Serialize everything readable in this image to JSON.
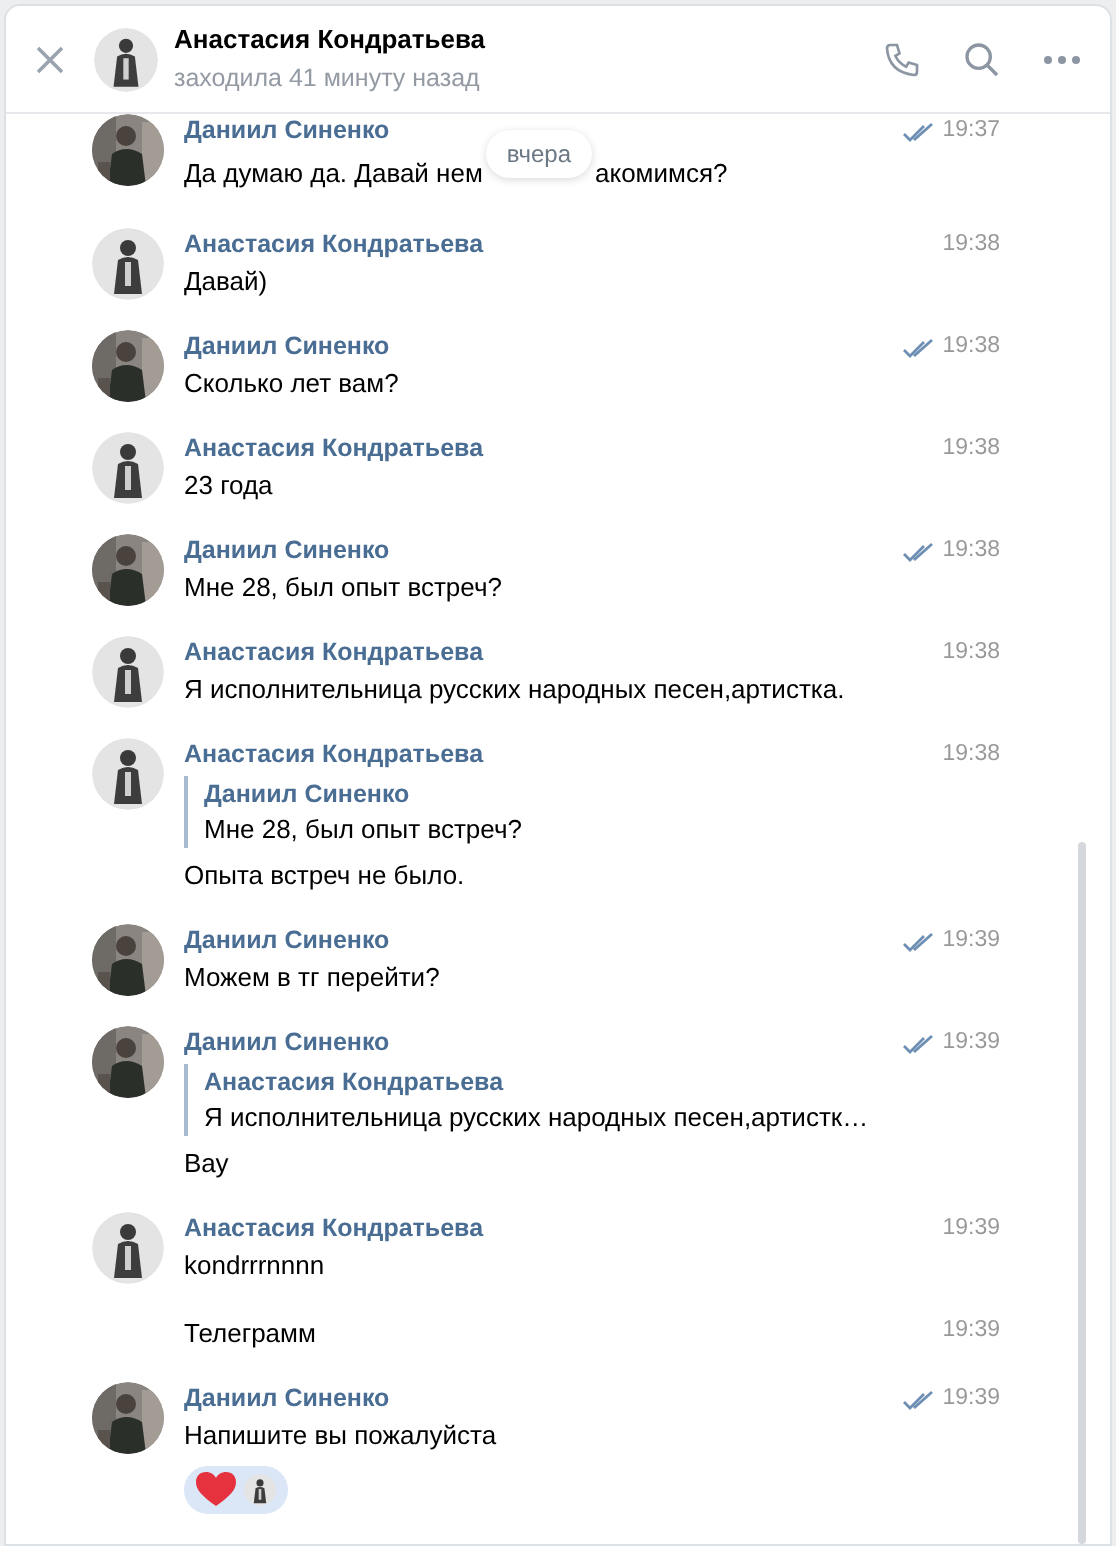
{
  "header": {
    "name": "Анастасия Кондратьева",
    "status": "заходила 41 минуту назад"
  },
  "date_badge": "вчера",
  "messages": [
    {
      "author": "Даниил Синенко",
      "avatar": {
        "kind": "dark"
      },
      "time": "19:37",
      "read": true,
      "text_parts": [
        "Да думаю да. Давай нем",
        "акомимся?"
      ]
    },
    {
      "author": "Анастасия Кондратьева",
      "avatar": {
        "kind": "light"
      },
      "time": "19:38",
      "read": false,
      "text_parts": [
        "Давай)"
      ]
    },
    {
      "author": "Даниил Синенко",
      "avatar": {
        "kind": "dark"
      },
      "time": "19:38",
      "read": true,
      "text_parts": [
        "Сколько лет вам?"
      ]
    },
    {
      "author": "Анастасия Кондратьева",
      "avatar": {
        "kind": "light"
      },
      "time": "19:38",
      "read": false,
      "text_parts": [
        "23 года"
      ]
    },
    {
      "author": "Даниил Синенко",
      "avatar": {
        "kind": "dark"
      },
      "time": "19:38",
      "read": true,
      "text_parts": [
        "Мне 28, был опыт встреч?"
      ]
    },
    {
      "author": "Анастасия Кондратьева",
      "avatar": {
        "kind": "light"
      },
      "time": "19:38",
      "read": false,
      "text_parts": [
        "Я исполнительница русских народных песен,артистка."
      ]
    },
    {
      "author": "Анастасия Кондратьева",
      "avatar": {
        "kind": "light"
      },
      "time": "19:38",
      "read": false,
      "reply": {
        "author": "Даниил Синенко",
        "text": "Мне 28, был опыт встреч?"
      },
      "text_parts": [
        "Опыта встреч не было."
      ]
    },
    {
      "author": "Даниил Синенко",
      "avatar": {
        "kind": "dark"
      },
      "time": "19:39",
      "read": true,
      "text_parts": [
        "Можем в тг перейти?"
      ]
    },
    {
      "author": "Даниил Синенко",
      "avatar": {
        "kind": "dark"
      },
      "time": "19:39",
      "read": true,
      "reply": {
        "author": "Анастасия Кондратьева",
        "text": "Я исполнительница русских народных песен,артистк…"
      },
      "text_parts": [
        "Вау"
      ]
    },
    {
      "author": "Анастасия Кондратьева",
      "avatar": {
        "kind": "light"
      },
      "time": "19:39",
      "read": false,
      "text_parts": [
        "kondrrrnnnn"
      ]
    },
    {
      "continuation": true,
      "time": "19:39",
      "read": false,
      "text_parts": [
        "Телеграмм"
      ]
    },
    {
      "author": "Даниил Синенко",
      "avatar": {
        "kind": "dark"
      },
      "time": "19:39",
      "read": true,
      "text_parts": [
        "Напишите вы пожалуйста"
      ],
      "reactions": [
        {
          "kind": "heart",
          "avatar": {
            "kind": "light"
          }
        }
      ]
    }
  ]
}
